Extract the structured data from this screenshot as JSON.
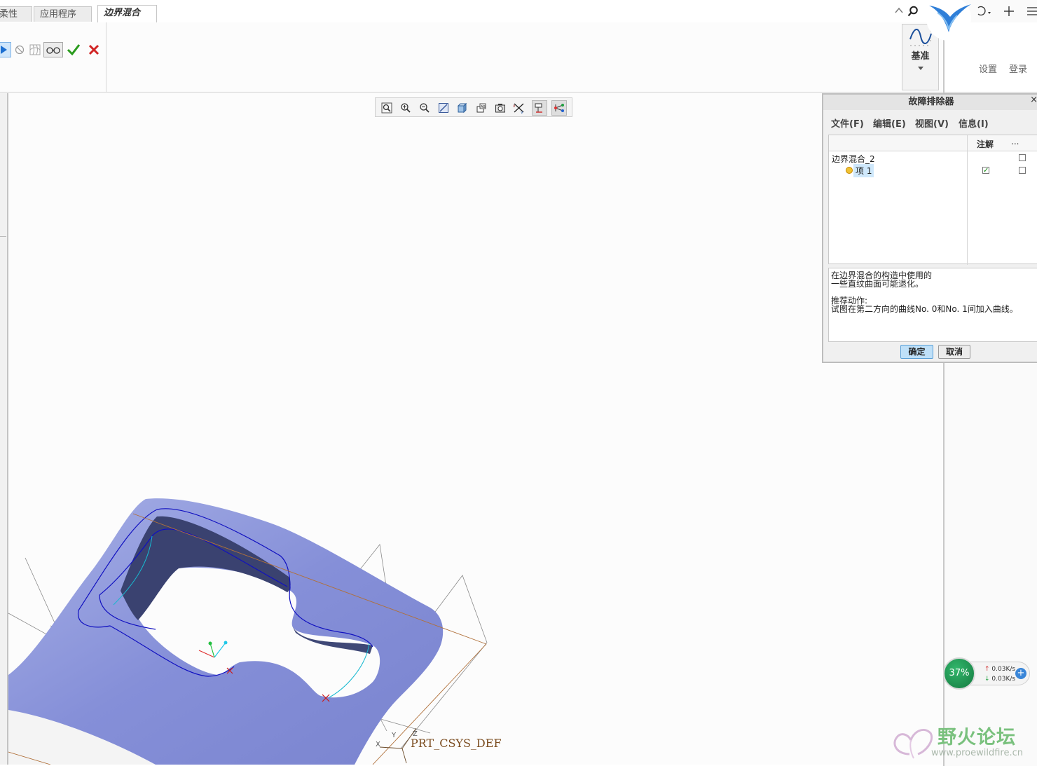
{
  "tabs": [
    {
      "label": "柔性建模",
      "active": false
    },
    {
      "label": "应用程序",
      "active": false
    },
    {
      "label": "边界混合",
      "active": true
    }
  ],
  "ribbon": {
    "datum_label": "基准",
    "icons": [
      "play-icon",
      "pause-icon",
      "preview-mesh-icon",
      "glasses-preview-icon",
      "confirm-check-icon",
      "cancel-x-icon"
    ]
  },
  "header": {
    "settings_label": "设置",
    "login_label": "登录",
    "icons": [
      "collapse-up-icon",
      "search-icon",
      "bird-logo-icon",
      "undo-icon",
      "add-icon",
      "menu-icon"
    ]
  },
  "view_toolbar": {
    "icons": [
      "refit-icon",
      "zoom-in-icon",
      "zoom-out-icon",
      "repaint-icon",
      "display-style-icon",
      "saved-views-icon",
      "view-manager-icon",
      "datum-display-icon",
      "annotation-display-icon",
      "spin-center-icon"
    ]
  },
  "troubleshooter": {
    "title": "故障排除器",
    "close_label": "×",
    "menu": [
      "文件(F)",
      "编辑(E)",
      "视图(V)",
      "信息(I)"
    ],
    "columns": {
      "note": "注解",
      "more": "..."
    },
    "tree": [
      {
        "label": "边界混合_2",
        "indent": 0,
        "note_checked": false,
        "other_checked": false
      },
      {
        "label": "项 1",
        "indent": 1,
        "note_checked": true,
        "other_checked": false,
        "selected": true
      }
    ],
    "message_lines": [
      "在边界混合的构造中使用的",
      "一些直纹曲面可能退化。",
      "",
      "推荐动作:",
      "试图在第二方向的曲线No. 0和No. 1间加入曲线。"
    ],
    "ok_label": "确定",
    "cancel_label": "取消"
  },
  "model": {
    "csys_label": "PRT_CSYS_DEF",
    "csys_axes": {
      "x": "X",
      "y": "Y",
      "z": "Z"
    },
    "surface_color": "#8a93d8",
    "edge_color": "#1010c0",
    "datum_color": "#b0703a"
  },
  "net_monitor": {
    "percent": "37%",
    "upload": "0.03K/s",
    "download": "0.03K/s"
  },
  "watermark": {
    "text": "野火论坛",
    "url": "www.proewildfire.cn"
  }
}
